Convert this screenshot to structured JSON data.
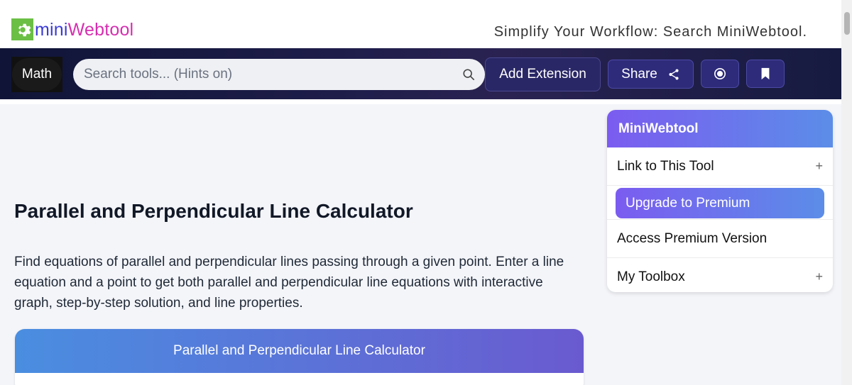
{
  "brand": {
    "part1": "mini",
    "part2": "Webtool",
    "tagline": "Simplify Your Workflow: Search MiniWebtool."
  },
  "nav": {
    "math_label": "Math",
    "search_placeholder": "Search tools... (Hints on)",
    "add_extension_label": "Add Extension",
    "share_label": "Share"
  },
  "icons": {
    "logo": "gear-icon",
    "search": "search-icon",
    "share": "share-icon",
    "record": "record-icon",
    "bookmark": "bookmark-icon"
  },
  "main": {
    "title": "Parallel and Perpendicular Line Calculator",
    "description": "Find equations of parallel and perpendicular lines passing through a given point. Enter a line equation and a point to get both parallel and perpendicular line equations with interactive graph, step-by-step solution, and line properties.",
    "calculator_header": "Parallel and Perpendicular Line Calculator"
  },
  "sidebar": {
    "title": "MiniWebtool",
    "link_label": "Link to This Tool",
    "premium_button": "Upgrade to Premium",
    "access_premium": "Access Premium Version",
    "toolbox_label": "My Toolbox",
    "expand_symbol": "+"
  },
  "colors": {
    "brand_blue": "#3b3bd6",
    "brand_pink": "#d62fb0",
    "logo_green": "#6bbf45",
    "nav_dark": "#101537",
    "accent_purple": "#7b5cf0",
    "accent_blue": "#5b8de8"
  }
}
